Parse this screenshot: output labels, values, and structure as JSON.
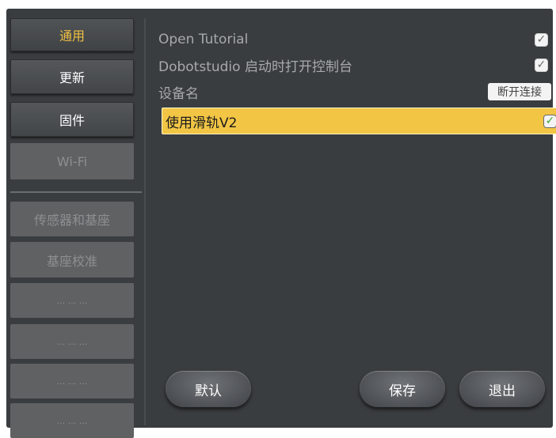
{
  "sidebar": {
    "items": [
      {
        "label": "通用",
        "state": "active"
      },
      {
        "label": "更新",
        "state": "enabled"
      },
      {
        "label": "固件",
        "state": "enabled"
      },
      {
        "label": "Wi-Fi",
        "state": "disabled"
      },
      {
        "label": "传感器和基座",
        "state": "disabled"
      },
      {
        "label": "基座校准",
        "state": "disabled"
      },
      {
        "label": "... ... ...",
        "state": "disabled"
      },
      {
        "label": "... ... ...",
        "state": "disabled"
      },
      {
        "label": "... ... ...",
        "state": "disabled"
      },
      {
        "label": "... ... ...",
        "state": "disabled"
      }
    ]
  },
  "settings": {
    "open_tutorial": {
      "label": "Open Tutorial",
      "checked": true
    },
    "console_on_start": {
      "label": "Dobotstudio 启动时打开控制台",
      "checked": true
    },
    "device_name": {
      "label": "设备名",
      "button": "断开连接"
    },
    "use_rail_v2": {
      "label": "使用滑轨V2",
      "checked": true
    }
  },
  "footer": {
    "default_label": "默认",
    "save_label": "保存",
    "exit_label": "退出"
  },
  "colors": {
    "background": "#3a3d40",
    "accent": "#f2c545",
    "active_text": "#f0c040"
  },
  "icons": {
    "check": "checkmark-icon"
  }
}
